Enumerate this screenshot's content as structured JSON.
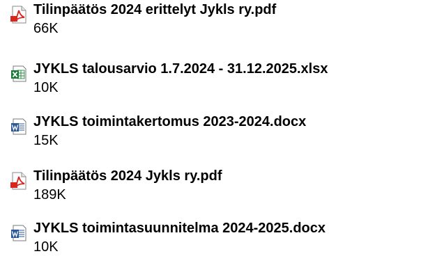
{
  "files": [
    {
      "name": "Tilinpäätös 2024 erittelyt Jykls ry.pdf",
      "size": "66K",
      "icon": "pdf-icon"
    },
    {
      "name": "JYKLS talousarvio 1.7.2024 - 31.12.2025.xlsx",
      "size": "10K",
      "icon": "excel-icon"
    },
    {
      "name": "JYKLS toimintakertomus 2023-2024.docx",
      "size": "15K",
      "icon": "word-icon"
    },
    {
      "name": "Tilinpäätös 2024 Jykls ry.pdf",
      "size": "189K",
      "icon": "pdf-icon"
    },
    {
      "name": "JYKLS toimintasuunnitelma 2024-2025.docx",
      "size": "10K",
      "icon": "word-icon"
    }
  ],
  "colors": {
    "pdf": "#d9251c",
    "excel": "#1e7b3a",
    "word": "#2b5797",
    "text": "#000000"
  }
}
